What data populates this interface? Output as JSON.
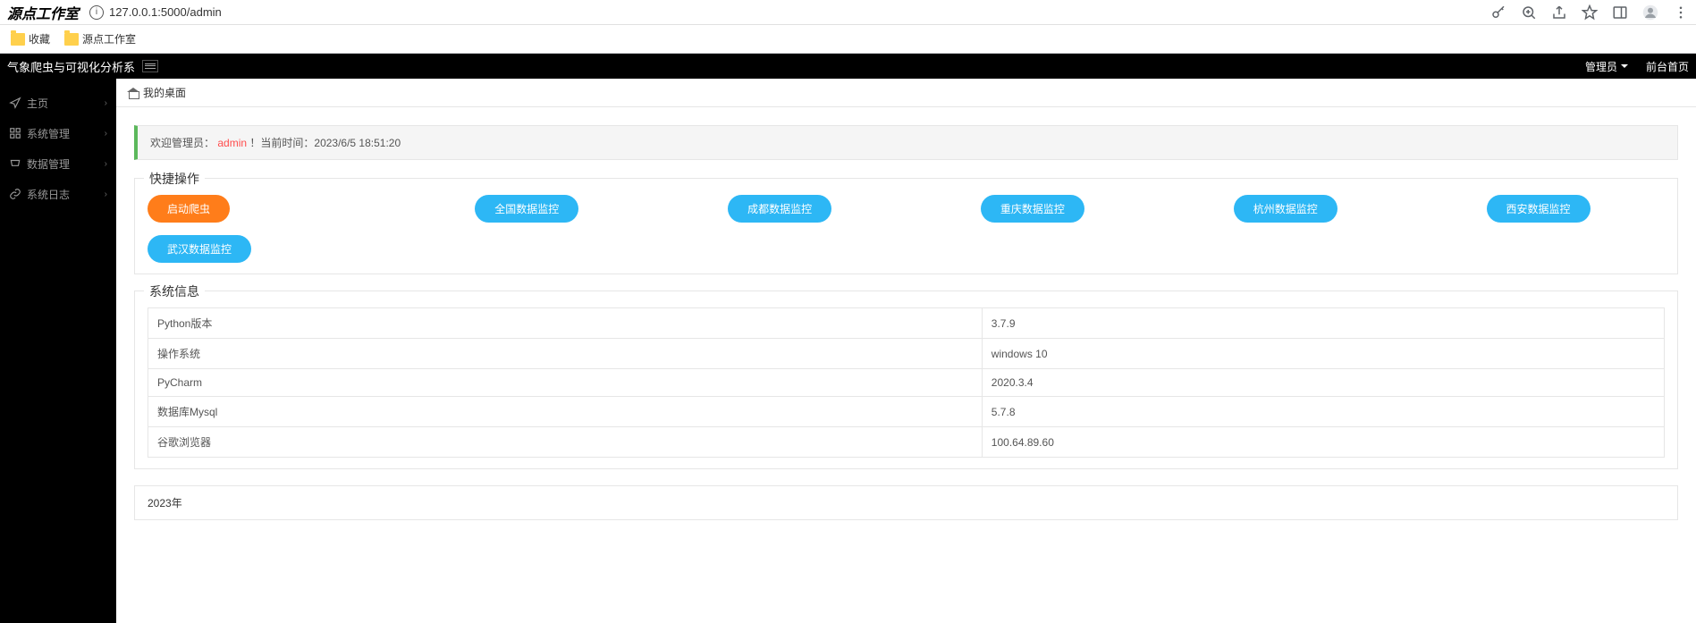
{
  "browser": {
    "tab_title": "源点工作室",
    "url": "127.0.0.1:5000/admin",
    "bookmarks": [
      "收藏",
      "源点工作室"
    ]
  },
  "header": {
    "app_title": "气象爬虫与可视化分析系",
    "admin_label": "管理员",
    "front_label": "前台首页"
  },
  "sidebar": {
    "items": [
      {
        "label": "主页"
      },
      {
        "label": "系统管理"
      },
      {
        "label": "数据管理"
      },
      {
        "label": "系统日志"
      }
    ]
  },
  "breadcrumb": {
    "text": "我的桌面"
  },
  "welcome": {
    "prefix": "欢迎管理员：",
    "admin": "admin",
    "suffix": "！当前时间：2023/6/5 18:51:20"
  },
  "quick_ops": {
    "title": "快捷操作",
    "buttons": [
      {
        "label": "启动爬虫",
        "style": "orange"
      },
      {
        "label": "全国数据监控",
        "style": "blue"
      },
      {
        "label": "成都数据监控",
        "style": "blue"
      },
      {
        "label": "重庆数据监控",
        "style": "blue"
      },
      {
        "label": "杭州数据监控",
        "style": "blue"
      },
      {
        "label": "西安数据监控",
        "style": "blue"
      },
      {
        "label": "武汉数据监控",
        "style": "blue"
      }
    ]
  },
  "sys_info": {
    "title": "系统信息",
    "rows": [
      {
        "key": "Python版本",
        "value": "3.7.9"
      },
      {
        "key": "操作系统",
        "value": "windows 10"
      },
      {
        "key": "PyCharm",
        "value": "2020.3.4"
      },
      {
        "key": "数据库Mysql",
        "value": "5.7.8"
      },
      {
        "key": "谷歌浏览器",
        "value": "100.64.89.60"
      }
    ]
  },
  "footer": {
    "text": "2023年"
  }
}
